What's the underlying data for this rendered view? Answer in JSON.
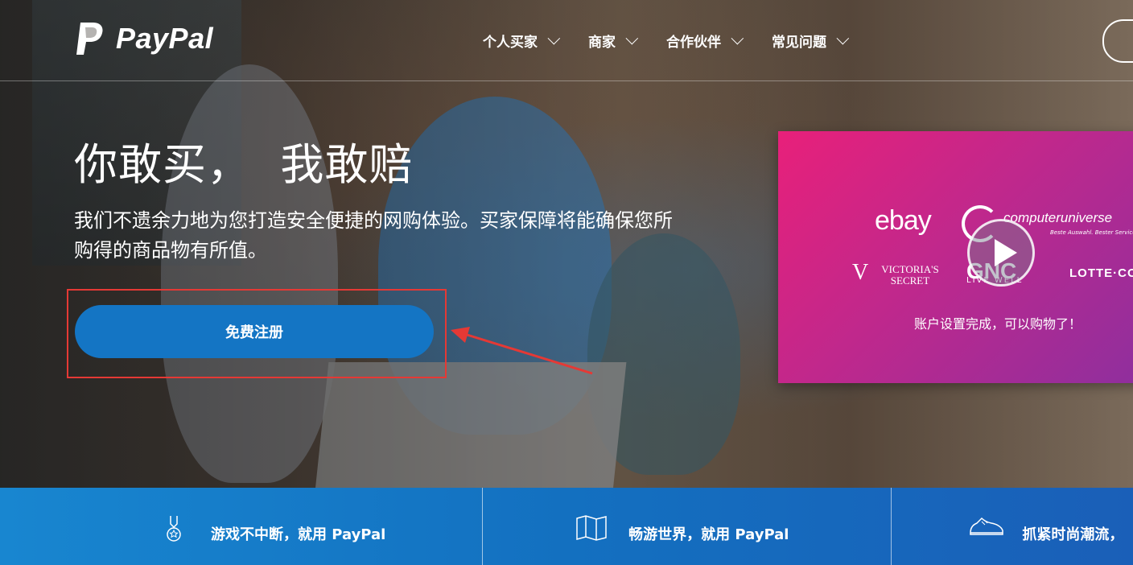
{
  "brand": {
    "name": "PayPal"
  },
  "nav": {
    "items": [
      {
        "label": "个人买家"
      },
      {
        "label": "商家"
      },
      {
        "label": "合作伙伴"
      },
      {
        "label": "常见问题"
      }
    ]
  },
  "hero": {
    "headline": "你敢买，  我敢赔",
    "subtext": "我们不遗余力地为您打造安全便捷的网购体验。买家保障将能确保您所购得的商品物有所值。",
    "signup_label": "免费注册"
  },
  "video_card": {
    "brands": {
      "ebay": "ebay",
      "computeruniverse": "computeruniverse",
      "computeruniverse_sub": "Beste Auswahl. Bester Service.",
      "victorias_secret": "VICTORIA'S SECRET",
      "gnc": "GNC",
      "gnc_sub": "LIVE WELL",
      "lotte": "LOTTE·CO"
    },
    "caption": "账户设置完成，可以购物了！"
  },
  "features": [
    {
      "label": "游戏不中断，就用 PayPal",
      "icon": "medal-icon"
    },
    {
      "label": "畅游世界，就用 PayPal",
      "icon": "map-icon"
    },
    {
      "label": "抓紧时尚潮流，",
      "icon": "sneaker-icon"
    }
  ],
  "colors": {
    "primary_button": "#1475c4",
    "highlight_box": "#e53935",
    "video_card_start": "#e8207a",
    "video_card_end": "#8e2f9e",
    "features_bar": "#1370c0"
  }
}
